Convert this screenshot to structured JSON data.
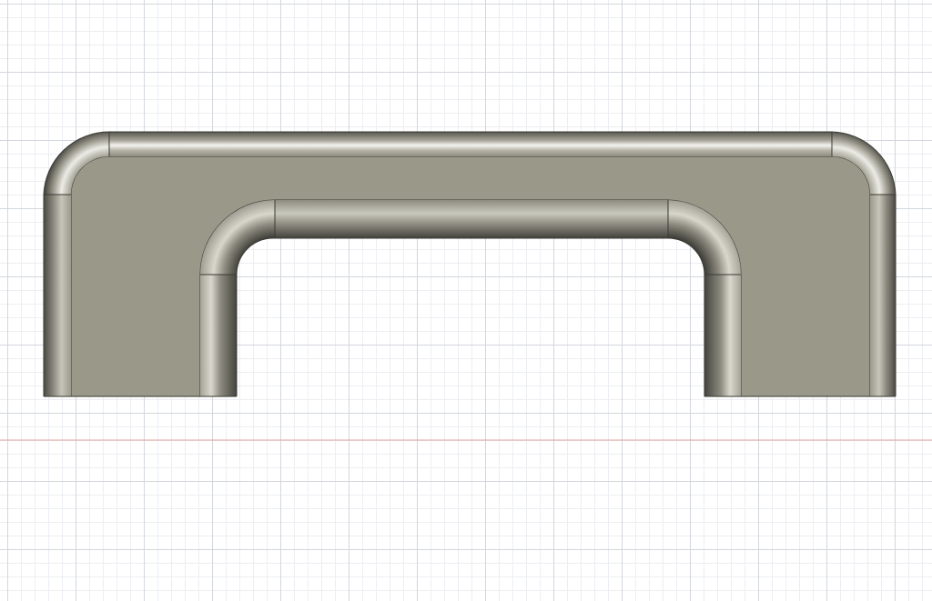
{
  "viewport": {
    "background": "#ffffff",
    "minor_grid_color": "#eceef2",
    "major_grid_color": "#d3d7dd",
    "axis_color": "#e6a79c"
  },
  "model": {
    "name": "handle-body",
    "face_color": "#9a9888",
    "edge_color": "#3a3a36",
    "highlight_color": "#f2f2ee",
    "shadow_color": "#4a4a44"
  }
}
